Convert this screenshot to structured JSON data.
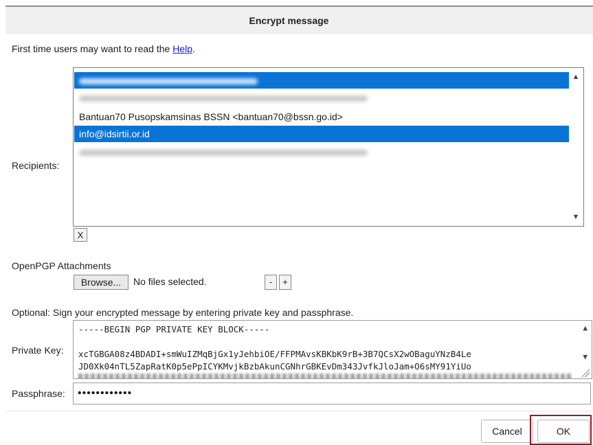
{
  "dialog": {
    "title": "Encrypt message",
    "help_prefix": "First time users may want to read the ",
    "help_link": "Help",
    "help_suffix": "."
  },
  "recipients": {
    "label": "Recipients:",
    "items": [
      {
        "text": "",
        "selected": true
      },
      {
        "text": "",
        "selected": false
      },
      {
        "text": "Bantuan70 Pusopskamsinas BSSN <bantuan70@bssn.go.id>",
        "selected": false
      },
      {
        "text": "info@idsirtii.or.id",
        "selected": true
      },
      {
        "text": "",
        "selected": false
      }
    ],
    "remove_label": "X"
  },
  "attachments": {
    "label": "OpenPGP Attachments",
    "browse_label": "Browse...",
    "status": "No files selected.",
    "minus_label": "-",
    "plus_label": "+"
  },
  "signing": {
    "instruction": "Optional: Sign your encrypted message by entering private key and passphrase.",
    "private_key_label": "Private Key:",
    "private_key_lines": [
      "-----BEGIN PGP PRIVATE KEY BLOCK-----",
      "",
      "xcTGBGA08z4BDADI+smWuIZMqBjGx1yJehbiOE/FFPMAvsKBKbK9rB+3B7QCsX2wOBaguYNzB4Le",
      "JD0Xk04nTL5ZapRatK0p5ePpICYKMvjkBzbAkunCGNhrGBKEvDm343JvfkJloJam+O6sMY91YiUo"
    ],
    "passphrase_label": "Passphrase:",
    "passphrase_value": "••••••••••••"
  },
  "footer": {
    "cancel_label": "Cancel",
    "ok_label": "OK"
  },
  "colors": {
    "selection": "#0a73d6",
    "link": "#0b21d6",
    "ok_highlight": "#8b1c2b"
  }
}
